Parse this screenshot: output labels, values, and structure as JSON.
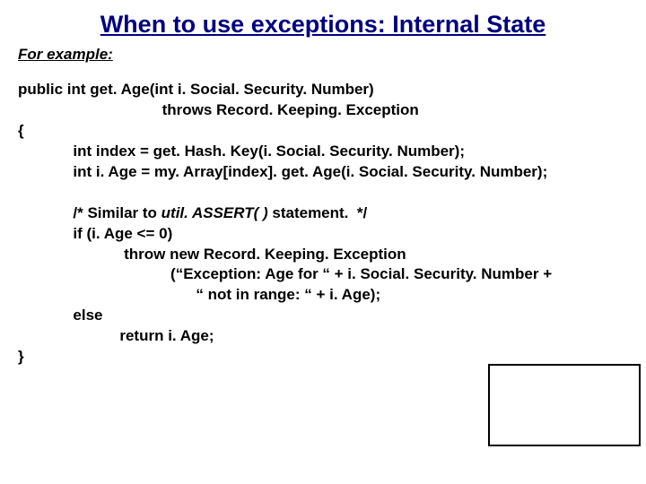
{
  "title": "When to use exceptions: Internal State",
  "subtitle": "For example:",
  "code": {
    "signature_line1": "public int get. Age(int i. Social. Security. Number)",
    "signature_line2": "                                  throws Record. Keeping. Exception",
    "open_brace": "{",
    "body_line1": "             int index = get. Hash. Key(i. Social. Security. Number);",
    "body_line2": "             int i. Age = my. Array[index]. get. Age(i. Social. Security. Number);",
    "comment_prefix": "             /* Similar to ",
    "comment_italic": "util. ASSERT( )",
    "comment_suffix": " statement.  */",
    "if_line": "             if (i. Age <= 0)",
    "throw_line": "                         throw new Record. Keeping. Exception",
    "throw_arg1": "                                    (“Exception: Age for “ + i. Social. Security. Number +",
    "throw_arg2": "                                          “ not in range: “ + i. Age);",
    "else_line": "             else",
    "return_line": "                        return i. Age;",
    "close_brace": "}"
  }
}
